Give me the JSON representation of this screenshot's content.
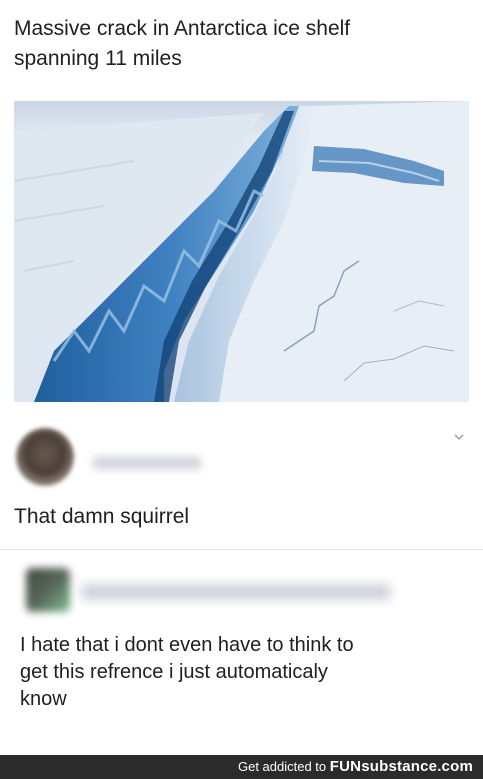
{
  "post": {
    "title_line1": "Massive crack in Antarctica ice shelf",
    "title_line2": "spanning 11 miles"
  },
  "comments": [
    {
      "text": "That damn squirrel",
      "menu_icon": "chevron-down-icon"
    },
    {
      "text_line1": "I hate that i dont even have to think to",
      "text_line2": "get this refrence i just automaticaly",
      "text_line3": "know"
    }
  ],
  "footer": {
    "prefix": "Get addicted to ",
    "brand": "FUNsubstance.com"
  }
}
